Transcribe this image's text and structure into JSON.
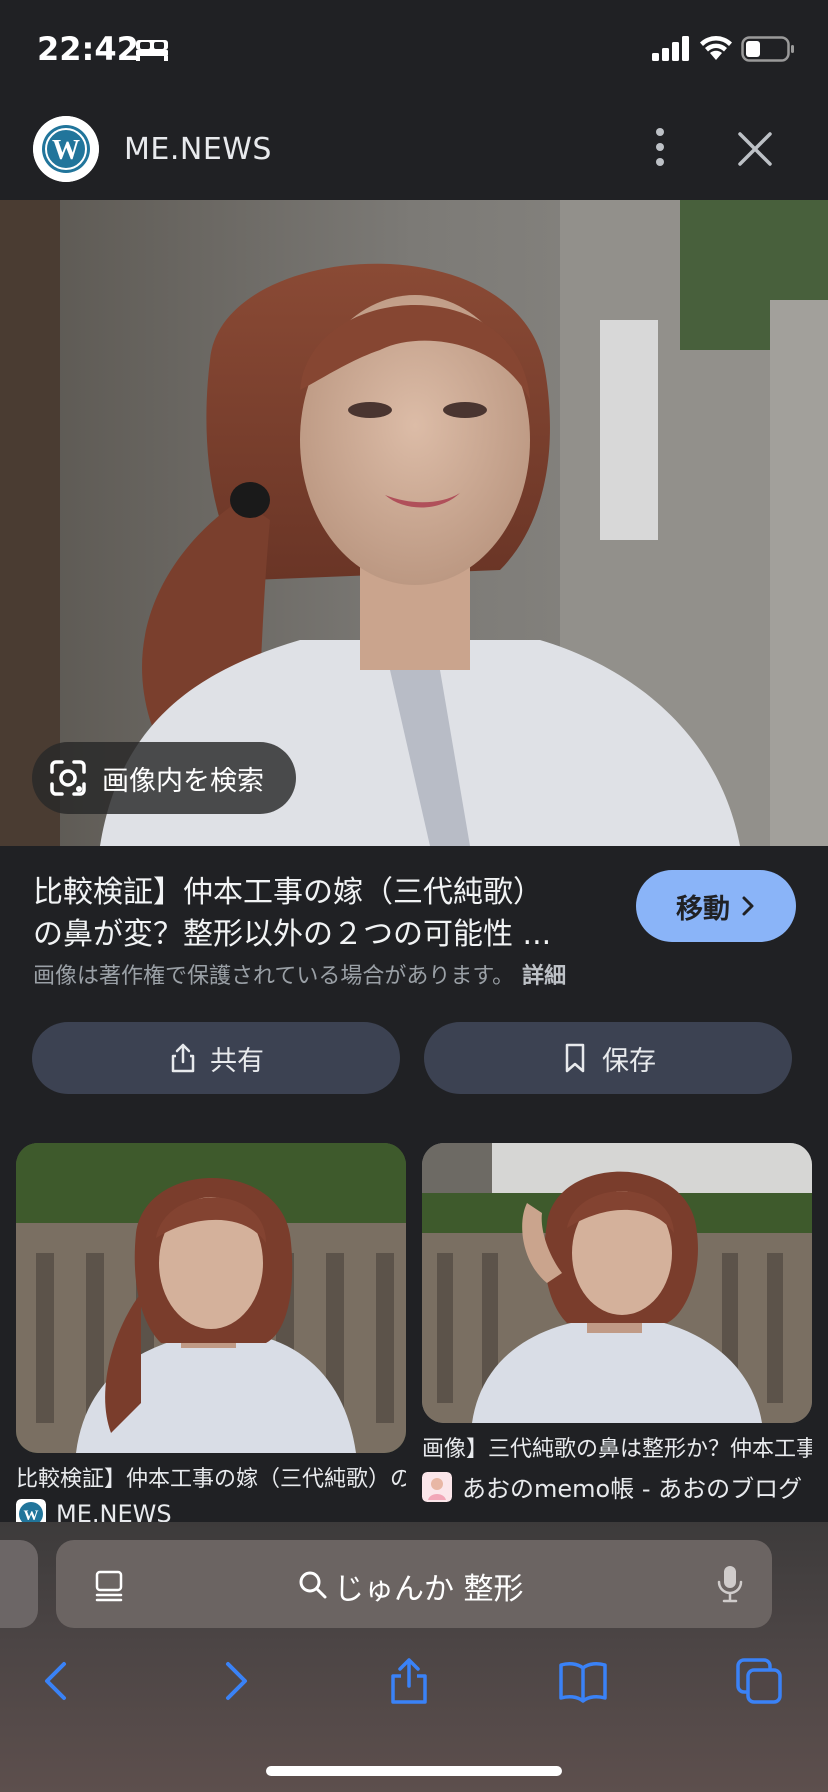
{
  "status_bar": {
    "time": "22:42",
    "icons": [
      "bed-icon",
      "cellular-signal-icon",
      "wifi-icon",
      "battery-icon"
    ]
  },
  "source_header": {
    "site_name": "ME.NEWS",
    "logo_icon": "wordpress-logo-icon",
    "more_icon": "more-vertical-icon",
    "close_icon": "close-icon"
  },
  "main_image": {
    "lens_label": "画像内を検索",
    "lens_icon": "lens-icon"
  },
  "result": {
    "title_line1": "比較検証】仲本工事の嫁（三代純歌）",
    "title_line2": "の鼻が変？整形以外の２つの可能性 ...",
    "visit_label": "移動",
    "copyright_note": "画像は著作権で保護されている場合があります。",
    "details_label": "詳細",
    "share_label": "共有",
    "save_label": "保存"
  },
  "related": [
    {
      "title": "比較検証】仲本工事の嫁（三代純歌）の鼻が変？",
      "source": "ME.NEWS"
    },
    {
      "title": "画像】三代純歌の鼻は整形か？仲本工事の嫁",
      "source": "あおのmemo帳 - あおのブログ"
    }
  ],
  "safari": {
    "address_text": "じゅんか 整形",
    "toolbar_icons": [
      "back-icon",
      "forward-icon",
      "share-icon",
      "bookmarks-icon",
      "tabs-icon"
    ]
  },
  "colors": {
    "background": "#202124",
    "accent_button": "#8ab4f8",
    "action_button": "#3c4252",
    "safari_blue": "#3a82f7"
  }
}
